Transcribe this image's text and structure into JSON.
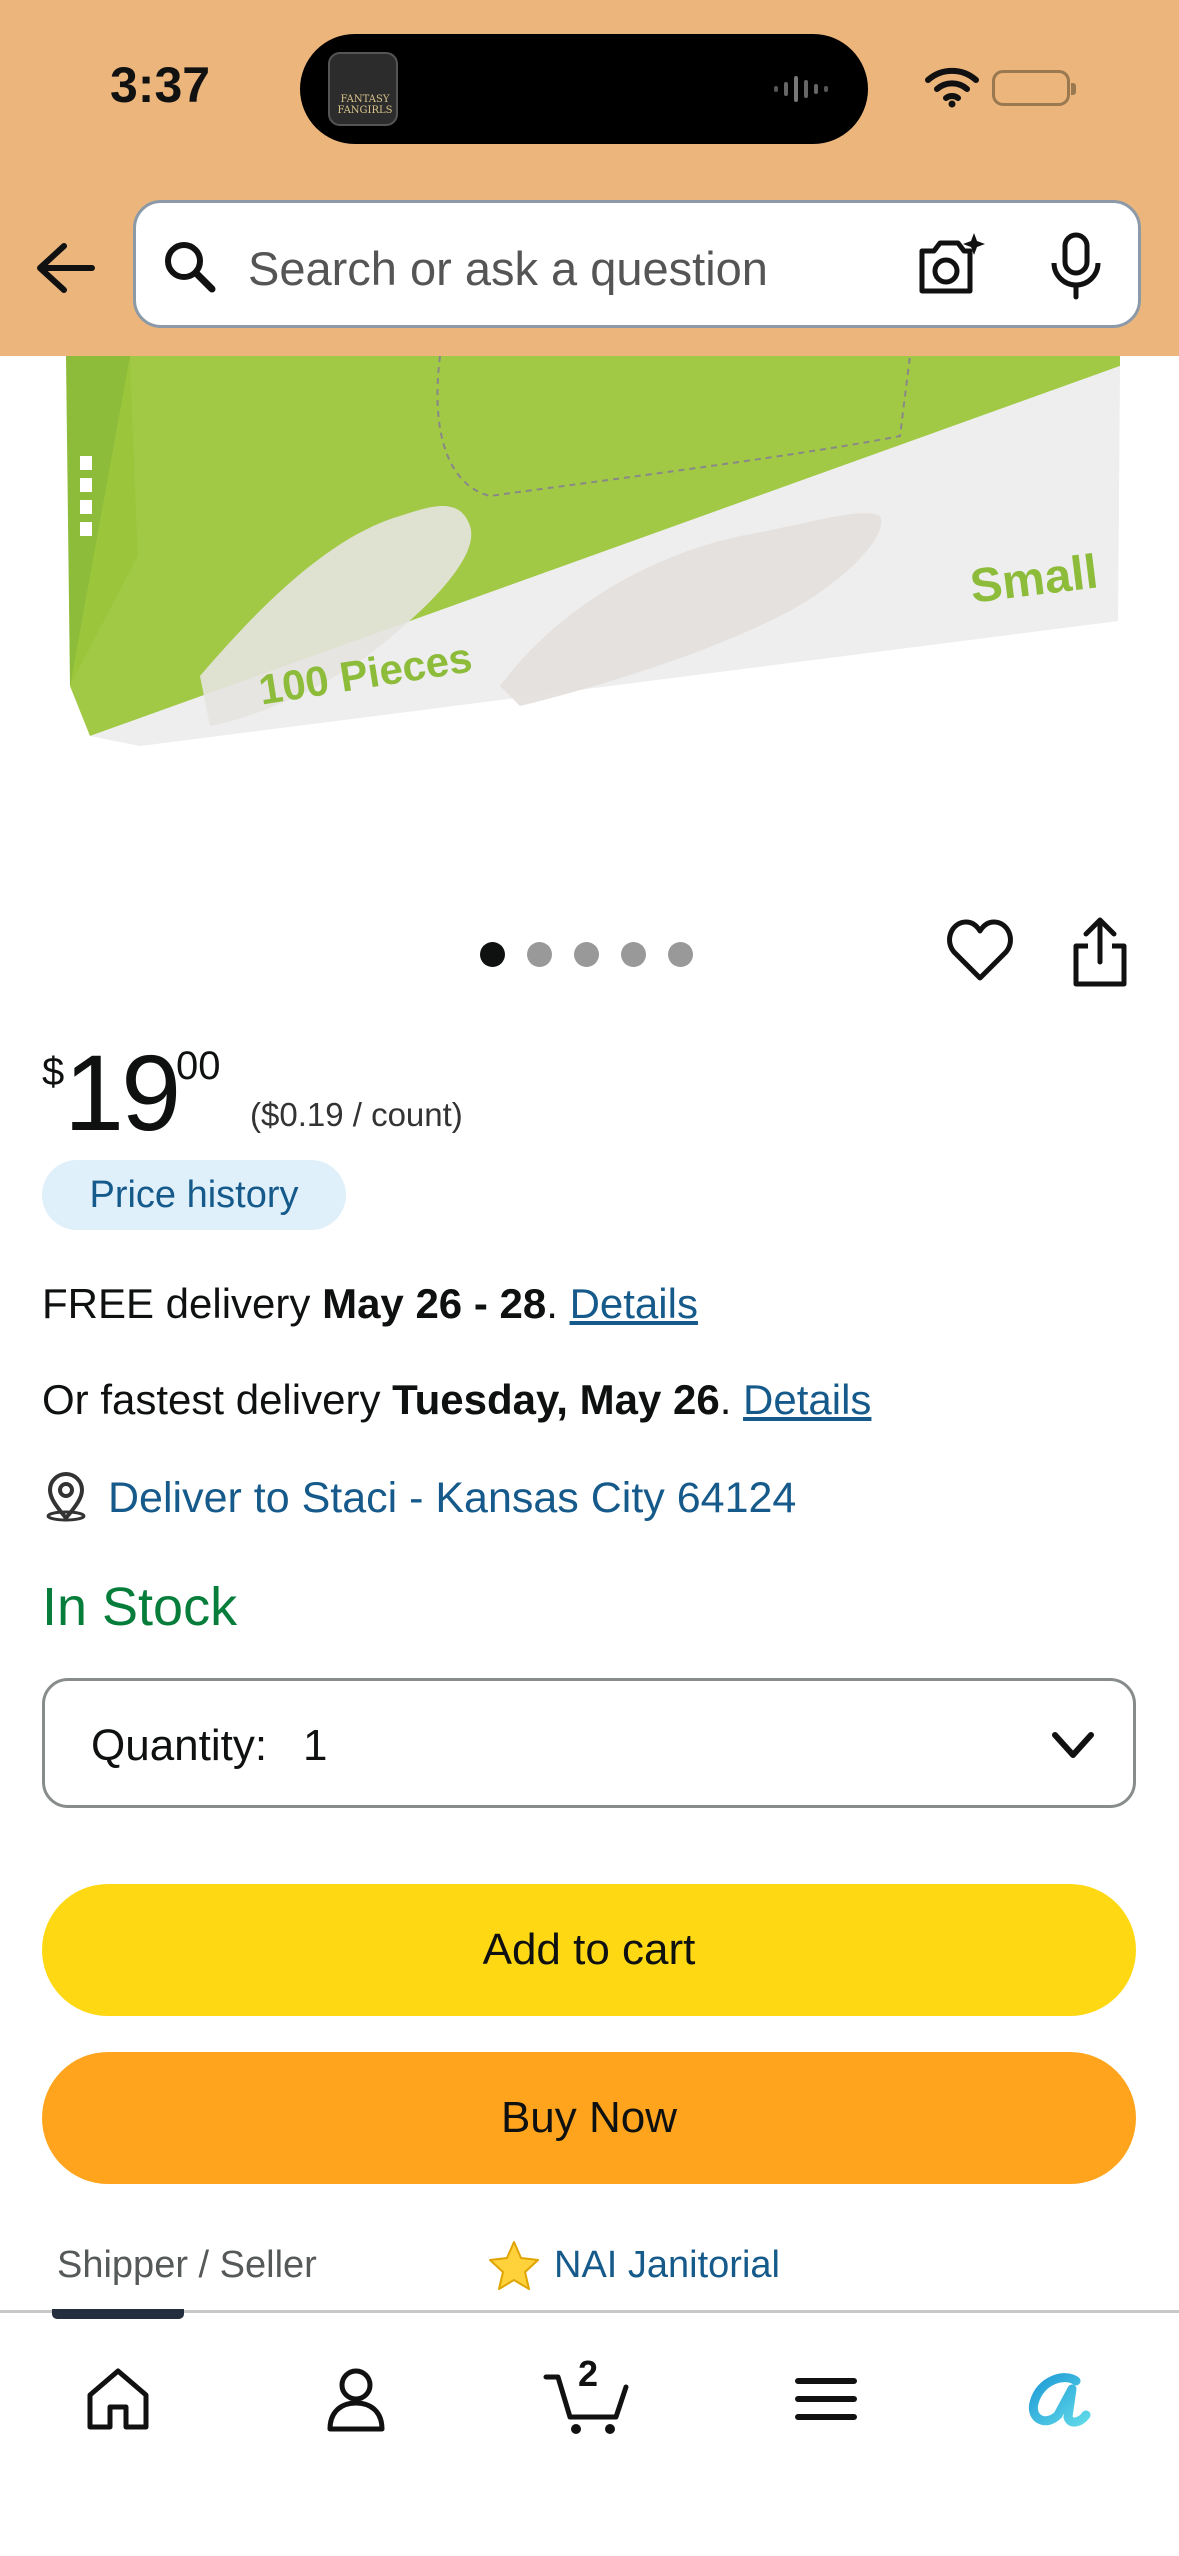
{
  "status_bar": {
    "time": "3:37",
    "island_app_label": "FANTASY FANGIRLS"
  },
  "header": {
    "search_placeholder": "Search or ask a question",
    "background_color": "#ebb57c"
  },
  "product_image": {
    "box_text_pieces": "100 Pieces",
    "box_text_size": "Small",
    "carousel": {
      "total": 5,
      "active_index": 0
    }
  },
  "price": {
    "symbol": "$",
    "whole": "19",
    "fraction": "00",
    "unit_price": "($0.19 / count)",
    "history_label": "Price history"
  },
  "delivery": {
    "free_prefix": "FREE delivery ",
    "free_dates": "May 26 - 28",
    "free_sep": ". ",
    "details_label": "Details",
    "fast_prefix": "Or fastest delivery ",
    "fast_date": "Tuesday, May 26",
    "fast_sep": ". ",
    "details_label_2": "Details",
    "deliver_to": "Deliver to Staci - Kansas City 64124"
  },
  "stock": {
    "status": "In Stock",
    "color": "#067d3a"
  },
  "quantity": {
    "label": "Quantity:",
    "value": "1"
  },
  "buttons": {
    "add_to_cart": "Add to cart",
    "buy_now": "Buy Now",
    "add_color": "#ffd814",
    "buy_color": "#ffa41c"
  },
  "seller": {
    "label": "Shipper / Seller",
    "name": "NAI Janitorial"
  },
  "bottom_nav": {
    "cart_count": "2",
    "items": [
      "home-icon",
      "account-icon",
      "cart-icon",
      "menu-icon",
      "rufus-icon"
    ]
  }
}
